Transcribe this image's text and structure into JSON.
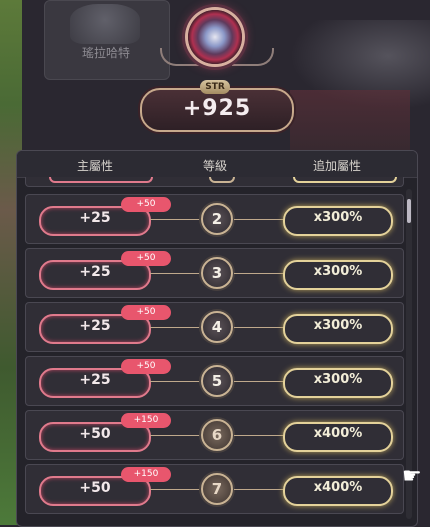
{
  "background": {
    "card_label": "瑤拉哈特"
  },
  "stat": {
    "name": "STR",
    "value": "+925"
  },
  "table": {
    "headers": {
      "main": "主屬性",
      "level": "等級",
      "extra": "追加屬性"
    },
    "rows": [
      {
        "main": "+25",
        "bonus": "+50",
        "level": "2",
        "extra": "x300%"
      },
      {
        "main": "+25",
        "bonus": "+50",
        "level": "3",
        "extra": "x300%"
      },
      {
        "main": "+25",
        "bonus": "+50",
        "level": "4",
        "extra": "x300%"
      },
      {
        "main": "+25",
        "bonus": "+50",
        "level": "5",
        "extra": "x300%"
      },
      {
        "main": "+50",
        "bonus": "+150",
        "level": "6",
        "extra": "x400%"
      },
      {
        "main": "+50",
        "bonus": "+150",
        "level": "7",
        "extra": "x400%"
      }
    ]
  },
  "icons": {
    "emblem": "gem-emblem-icon",
    "cursor": "hand-pointer-icon"
  },
  "colors": {
    "main_pill": "#e07a8c",
    "bonus_badge": "#e8566d",
    "extra_pill": "#e4d29a",
    "level_ring": "#c9b394"
  }
}
